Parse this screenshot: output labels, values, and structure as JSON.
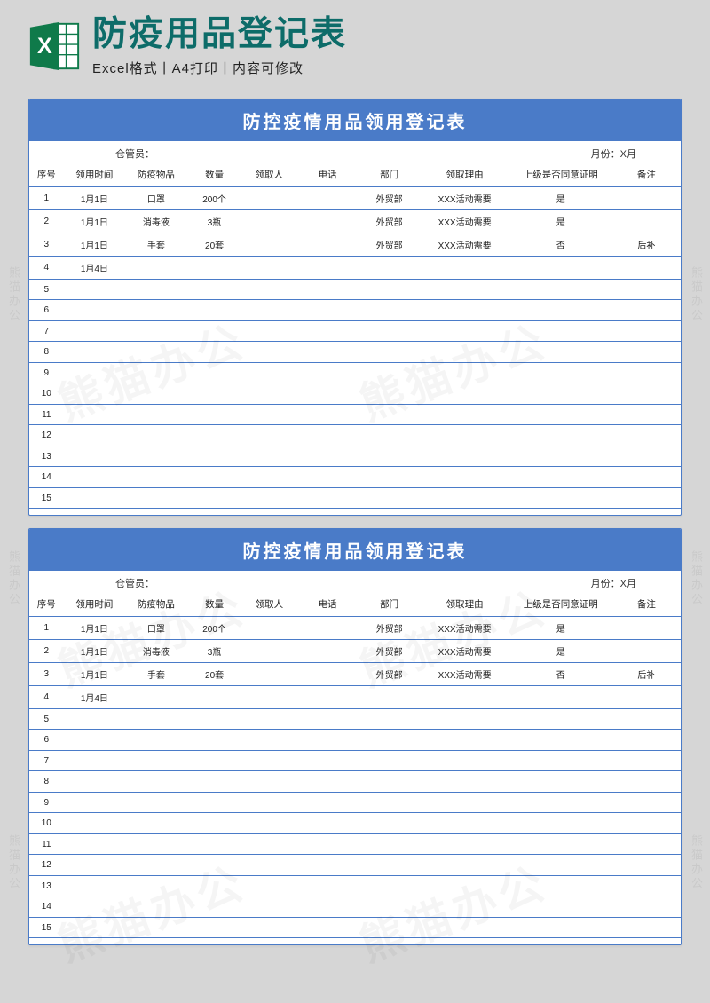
{
  "header": {
    "main_title": "防疫用品登记表",
    "sub_title": "Excel格式丨A4打印丨内容可修改",
    "icon_letter": "X"
  },
  "sheet": {
    "title": "防控疫情用品领用登记表",
    "meta_left": "仓管员：",
    "meta_right": "月份：X月",
    "headers": [
      "序号",
      "领用时间",
      "防疫物品",
      "数量",
      "领取人",
      "电话",
      "部门",
      "领取理由",
      "上级是否同意证明",
      "备注"
    ],
    "rows": [
      {
        "seq": "1",
        "time": "1月1日",
        "item": "口罩",
        "qty": "200个",
        "person": "",
        "phone": "",
        "dept": "外贸部",
        "reason": "XXX活动需要",
        "approved": "是",
        "note": ""
      },
      {
        "seq": "2",
        "time": "1月1日",
        "item": "消毒液",
        "qty": "3瓶",
        "person": "",
        "phone": "",
        "dept": "外贸部",
        "reason": "XXX活动需要",
        "approved": "是",
        "note": ""
      },
      {
        "seq": "3",
        "time": "1月1日",
        "item": "手套",
        "qty": "20套",
        "person": "",
        "phone": "",
        "dept": "外贸部",
        "reason": "XXX活动需要",
        "approved": "否",
        "note": "后补"
      },
      {
        "seq": "4",
        "time": "1月4日",
        "item": "",
        "qty": "",
        "person": "",
        "phone": "",
        "dept": "",
        "reason": "",
        "approved": "",
        "note": ""
      },
      {
        "seq": "5",
        "time": "",
        "item": "",
        "qty": "",
        "person": "",
        "phone": "",
        "dept": "",
        "reason": "",
        "approved": "",
        "note": ""
      },
      {
        "seq": "6",
        "time": "",
        "item": "",
        "qty": "",
        "person": "",
        "phone": "",
        "dept": "",
        "reason": "",
        "approved": "",
        "note": ""
      },
      {
        "seq": "7",
        "time": "",
        "item": "",
        "qty": "",
        "person": "",
        "phone": "",
        "dept": "",
        "reason": "",
        "approved": "",
        "note": ""
      },
      {
        "seq": "8",
        "time": "",
        "item": "",
        "qty": "",
        "person": "",
        "phone": "",
        "dept": "",
        "reason": "",
        "approved": "",
        "note": ""
      },
      {
        "seq": "9",
        "time": "",
        "item": "",
        "qty": "",
        "person": "",
        "phone": "",
        "dept": "",
        "reason": "",
        "approved": "",
        "note": ""
      },
      {
        "seq": "10",
        "time": "",
        "item": "",
        "qty": "",
        "person": "",
        "phone": "",
        "dept": "",
        "reason": "",
        "approved": "",
        "note": ""
      },
      {
        "seq": "11",
        "time": "",
        "item": "",
        "qty": "",
        "person": "",
        "phone": "",
        "dept": "",
        "reason": "",
        "approved": "",
        "note": ""
      },
      {
        "seq": "12",
        "time": "",
        "item": "",
        "qty": "",
        "person": "",
        "phone": "",
        "dept": "",
        "reason": "",
        "approved": "",
        "note": ""
      },
      {
        "seq": "13",
        "time": "",
        "item": "",
        "qty": "",
        "person": "",
        "phone": "",
        "dept": "",
        "reason": "",
        "approved": "",
        "note": ""
      },
      {
        "seq": "14",
        "time": "",
        "item": "",
        "qty": "",
        "person": "",
        "phone": "",
        "dept": "",
        "reason": "",
        "approved": "",
        "note": ""
      },
      {
        "seq": "15",
        "time": "",
        "item": "",
        "qty": "",
        "person": "",
        "phone": "",
        "dept": "",
        "reason": "",
        "approved": "",
        "note": ""
      }
    ]
  },
  "watermark": {
    "text": "熊猫办公",
    "side_text": "熊猫办公"
  }
}
